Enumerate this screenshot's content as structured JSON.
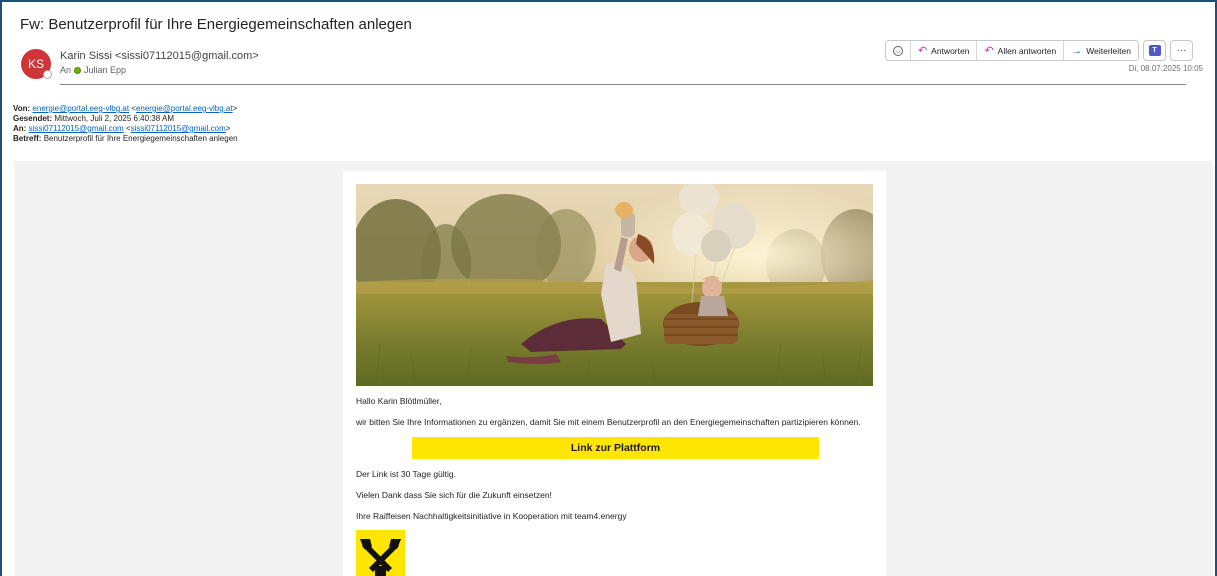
{
  "email": {
    "subject": "Fw: Benutzerprofil für Ihre Energiegemeinschaften anlegen",
    "avatar_initials": "KS",
    "sender": "Karin Sissi <sissi07112015@gmail.com>",
    "to_prefix": "An",
    "to_name": "Julian Epp",
    "date": "Di, 08.07.2025 10:05"
  },
  "toolbar": {
    "reply": "Antworten",
    "reply_all": "Allen antworten",
    "forward": "Weiterleiten",
    "more": "···"
  },
  "forwarded": {
    "from_label": "Von:",
    "from_link1": "energie@portal.eeg-vlbg.at",
    "from_link2": "energie@portal.eeg-vlbg.at",
    "sent_label": "Gesendet:",
    "sent_value": "Mittwoch, Juli 2, 2025 6:40:38 AM",
    "to_label": "An:",
    "to_link1": "sissi07112015@gmail.com",
    "to_link2": "sissi07112015@gmail.com",
    "subject_label": "Betreff:",
    "subject_value": "Benutzerprofil für Ihre Energiegemeinschaften anlegen"
  },
  "body": {
    "greeting": "Hallo Karin Blötlmüller,",
    "intro": "wir bitten Sie Ihre Informationen zu ergänzen, damit Sie mit einem Benutzerprofil an den Energiegemeinschaften partizipieren können.",
    "cta": "Link zur Plattform",
    "validity": "Der Link ist 30 Tage gültig.",
    "thanks": "Vielen Dank dass Sie sich für die Zukunft einsetzen!",
    "signoff": "Ihre Raiffeisen Nachhaltigkeitsinitiative in Kooperation mit team4.energy"
  },
  "colors": {
    "avatar": "#d13438",
    "link": "#0563c1",
    "cta_yellow": "#ffe600",
    "frame_border": "#1f4e79"
  }
}
